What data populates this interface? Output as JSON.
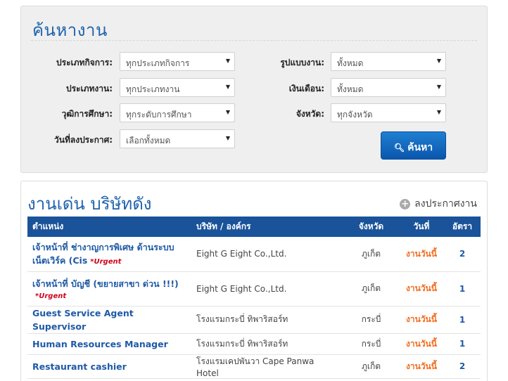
{
  "search": {
    "title": "ค้นหางาน",
    "fields": {
      "business_type": {
        "label": "ประเภทกิจการ:",
        "value": "ทุกประเภทกิจการ"
      },
      "job_type": {
        "label": "ประเภทงาน:",
        "value": "ทุกประเภทงาน"
      },
      "education": {
        "label": "วุฒิการศึกษา:",
        "value": "ทุกระดับการศึกษา"
      },
      "post_date": {
        "label": "วันที่ลงประกาศ:",
        "value": "เลือกทั้งหมด"
      },
      "work_format": {
        "label": "รูปแบบงาน:",
        "value": "ทั้งหมด"
      },
      "salary": {
        "label": "เงินเดือน:",
        "value": "ทั้งหมด"
      },
      "province": {
        "label": "จังหวัด:",
        "value": "ทุกจังหวัด"
      }
    },
    "button_label": "ค้นหา"
  },
  "featured": {
    "title": "งานเด่น บริษัทดัง",
    "post_job_label": "ลงประกาศงาน",
    "columns": {
      "position": "ตำแหน่ง",
      "company": "บริษัท / องค์กร",
      "province": "จังหวัด",
      "date": "วันที่",
      "count": "อัตรา"
    },
    "rows": [
      {
        "title": "เจ้าหน้าที่ ช่างาญการพิเศษ ด้านระบบเน็ตเวิร์ค (Cis",
        "urgent": "*Urgent",
        "company": "Eight G Eight Co.,Ltd.",
        "province": "ภูเก็ต",
        "date": "งานวันนี้",
        "count": "2"
      },
      {
        "title": "เจ้าหน้าที่ บัญชี (ขยายสาขา ด่วน !!!)",
        "urgent": "*Urgent",
        "company": "Eight G Eight Co.,Ltd.",
        "province": "ภูเก็ต",
        "date": "งานวันนี้",
        "count": "1"
      },
      {
        "title": "Guest Service Agent Supervisor",
        "urgent": "",
        "company": "โรงแรมกระบี่ ทิพาริสอร์ท",
        "province": "กระบี่",
        "date": "งานวันนี้",
        "count": "1"
      },
      {
        "title": "Human Resources Manager",
        "urgent": "",
        "company": "โรงแรมกระบี่ ทิพาริสอร์ท",
        "province": "กระบี่",
        "date": "งานวันนี้",
        "count": "1"
      },
      {
        "title": "Restaurant cashier",
        "urgent": "",
        "company": "โรงแรมเคปพันวา Cape Panwa Hotel",
        "province": "ภูเก็ต",
        "date": "งานวันนี้",
        "count": "2"
      }
    ]
  }
}
